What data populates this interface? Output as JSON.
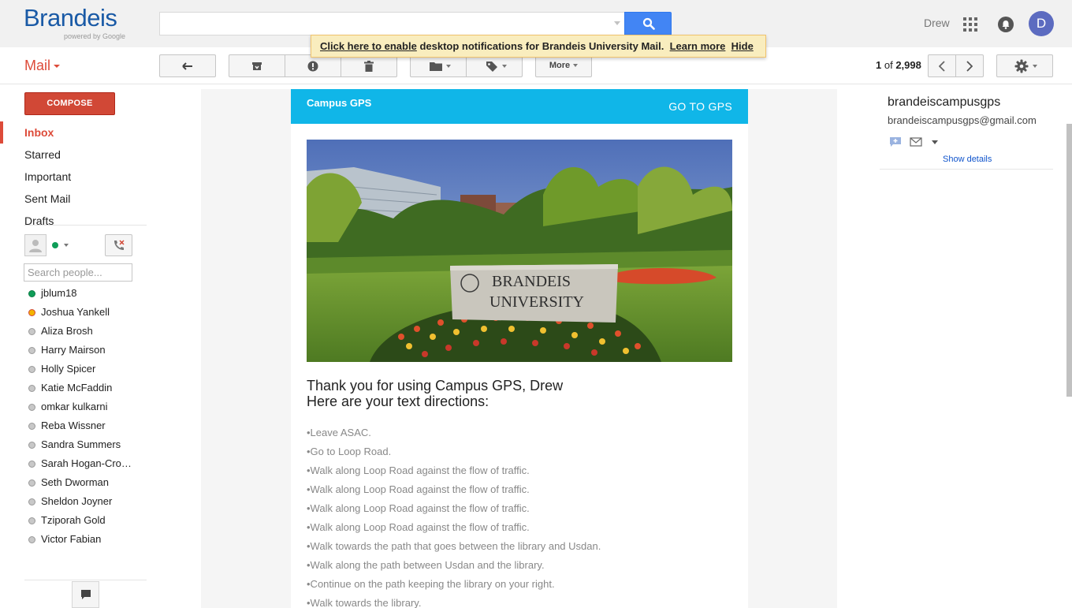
{
  "header": {
    "brand": "Brandeis",
    "powered_by": "powered by Google",
    "search_value": "",
    "user_name": "Drew",
    "avatar_initial": "D"
  },
  "notification": {
    "enable_link": "Click here to enable",
    "message": " desktop notifications for Brandeis University Mail. ",
    "learn_more": "Learn more",
    "hide": "Hide"
  },
  "toolbar": {
    "mail_label": "Mail",
    "more_label": "More",
    "page_range": "1",
    "page_of": " of ",
    "page_total": "2,998"
  },
  "nav": {
    "compose_label": "COMPOSE",
    "items": [
      "Inbox",
      "Starred",
      "Important",
      "Sent Mail",
      "Drafts"
    ]
  },
  "chat": {
    "search_placeholder": "Search people...",
    "contacts": [
      {
        "name": "jblum18",
        "status": "online"
      },
      {
        "name": "Joshua Yankell",
        "status": "away"
      },
      {
        "name": "Aliza Brosh",
        "status": "offline"
      },
      {
        "name": "Harry Mairson",
        "status": "offline"
      },
      {
        "name": "Holly Spicer",
        "status": "offline"
      },
      {
        "name": "Katie McFaddin",
        "status": "offline"
      },
      {
        "name": "omkar kulkarni",
        "status": "offline"
      },
      {
        "name": "Reba Wissner",
        "status": "offline"
      },
      {
        "name": "Sandra Summers",
        "status": "offline"
      },
      {
        "name": "Sarah Hogan-Cro…",
        "status": "offline"
      },
      {
        "name": "Seth Dworman",
        "status": "offline"
      },
      {
        "name": "Sheldon Joyner",
        "status": "offline"
      },
      {
        "name": "Tziporah Gold",
        "status": "offline"
      },
      {
        "name": "Victor Fabian",
        "status": "offline"
      }
    ]
  },
  "email": {
    "brand": "Campus GPS",
    "goto_label": "GO TO GPS",
    "hero_sign_line1": "BRANDEIS",
    "hero_sign_line2": "UNIVERSITY",
    "greeting": "Thank you for using Campus GPS, Drew",
    "subheading": "Here are your text directions:",
    "directions": [
      "•Leave ASAC.",
      "•Go to Loop Road.",
      "•Walk along Loop Road against the flow of traffic.",
      "•Walk along Loop Road against the flow of traffic.",
      "•Walk along Loop Road against the flow of traffic.",
      "•Walk along Loop Road against the flow of traffic.",
      "•Walk towards the path that goes between the library and Usdan.",
      "•Walk along the path between Usdan and the library.",
      "•Continue on the path keeping the library on your right.",
      "•Walk towards the library."
    ]
  },
  "sender": {
    "name": "brandeiscampusgps",
    "email": "brandeiscampusgps@gmail.com",
    "show_details": "Show details"
  },
  "colors": {
    "accent_red": "#dd4b39",
    "compose_red": "#d14836",
    "search_blue": "#4285f4",
    "gps_header": "#10b6e8",
    "notification_bg": "#f9edbe"
  }
}
